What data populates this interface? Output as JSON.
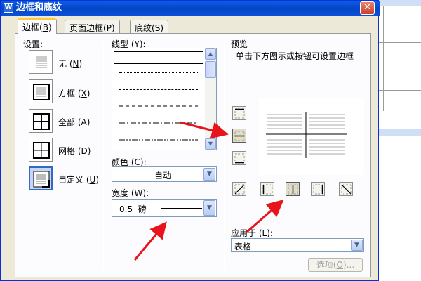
{
  "window": {
    "title": "边框和底纹",
    "app_icon": "W"
  },
  "tabs": [
    {
      "label": "边框",
      "key": "B",
      "active": true
    },
    {
      "label": "页面边框",
      "key": "P",
      "active": false
    },
    {
      "label": "底纹",
      "key": "S",
      "active": false
    }
  ],
  "settings": {
    "label": "设置:",
    "items": [
      {
        "label": "无",
        "key": "N",
        "icon": "border-none-icon"
      },
      {
        "label": "方框",
        "key": "X",
        "icon": "border-box-icon"
      },
      {
        "label": "全部",
        "key": "A",
        "icon": "border-all-icon"
      },
      {
        "label": "网格",
        "key": "D",
        "icon": "border-grid-icon"
      },
      {
        "label": "自定义",
        "key": "U",
        "icon": "border-custom-icon",
        "selected": true
      }
    ]
  },
  "line_style": {
    "label": "线型",
    "key": "Y",
    "styles": [
      "solid",
      "dotted",
      "dashed-short",
      "dashed",
      "dash-dot",
      "dash-dot-dot"
    ],
    "selected_index": 0
  },
  "color": {
    "label": "颜色",
    "key": "C",
    "value": "自动"
  },
  "width": {
    "label": "宽度",
    "key": "W",
    "value": "0.5  磅"
  },
  "preview": {
    "label": "预览",
    "hint": "单击下方图示或按钮可设置边框"
  },
  "apply_to": {
    "label": "应用于",
    "key": "L",
    "value": "表格"
  },
  "options_button": {
    "label": "选项",
    "key": "O",
    "suffix": "..."
  },
  "colors": {
    "title_bar": "#0545c8",
    "dialog_bg": "#ece9d8",
    "accent": "#316ac5",
    "annotation_arrow": "#e8141b"
  }
}
